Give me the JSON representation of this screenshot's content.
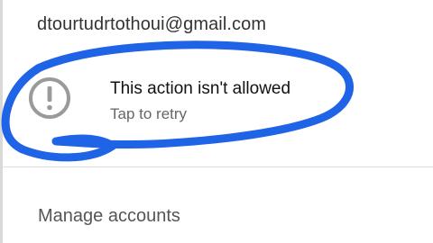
{
  "account": {
    "email": "dtourtudrtothoui@gmail.com"
  },
  "error": {
    "title": "This action isn't allowed",
    "subtitle": "Tap to retry",
    "icon": "alert-circle-icon"
  },
  "menu": {
    "manage_accounts": "Manage accounts"
  },
  "annotation": {
    "color": "#1f63e6"
  }
}
